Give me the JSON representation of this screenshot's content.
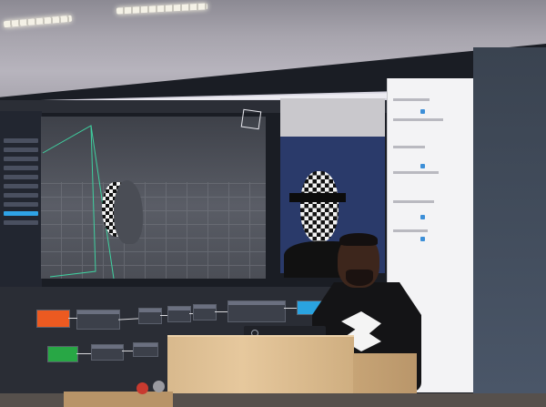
{
  "scene": {
    "description_free": true
  },
  "app_window": {
    "title_small": "",
    "graph_nodes": {
      "orange_node_label": "",
      "green_node_label": "",
      "blue_node_label": ""
    }
  },
  "colors": {
    "accent_orange": "#ec5a21",
    "accent_green": "#28a745",
    "accent_blue": "#2aa3e0",
    "selection_blue": "#2fa3e6",
    "podium_wood": "#e0c294"
  },
  "icons": {
    "view_cube": "view-cube-icon",
    "shirt_logo": "shirt-logo-icon",
    "laptop_logo": "laptop-logo-icon"
  }
}
